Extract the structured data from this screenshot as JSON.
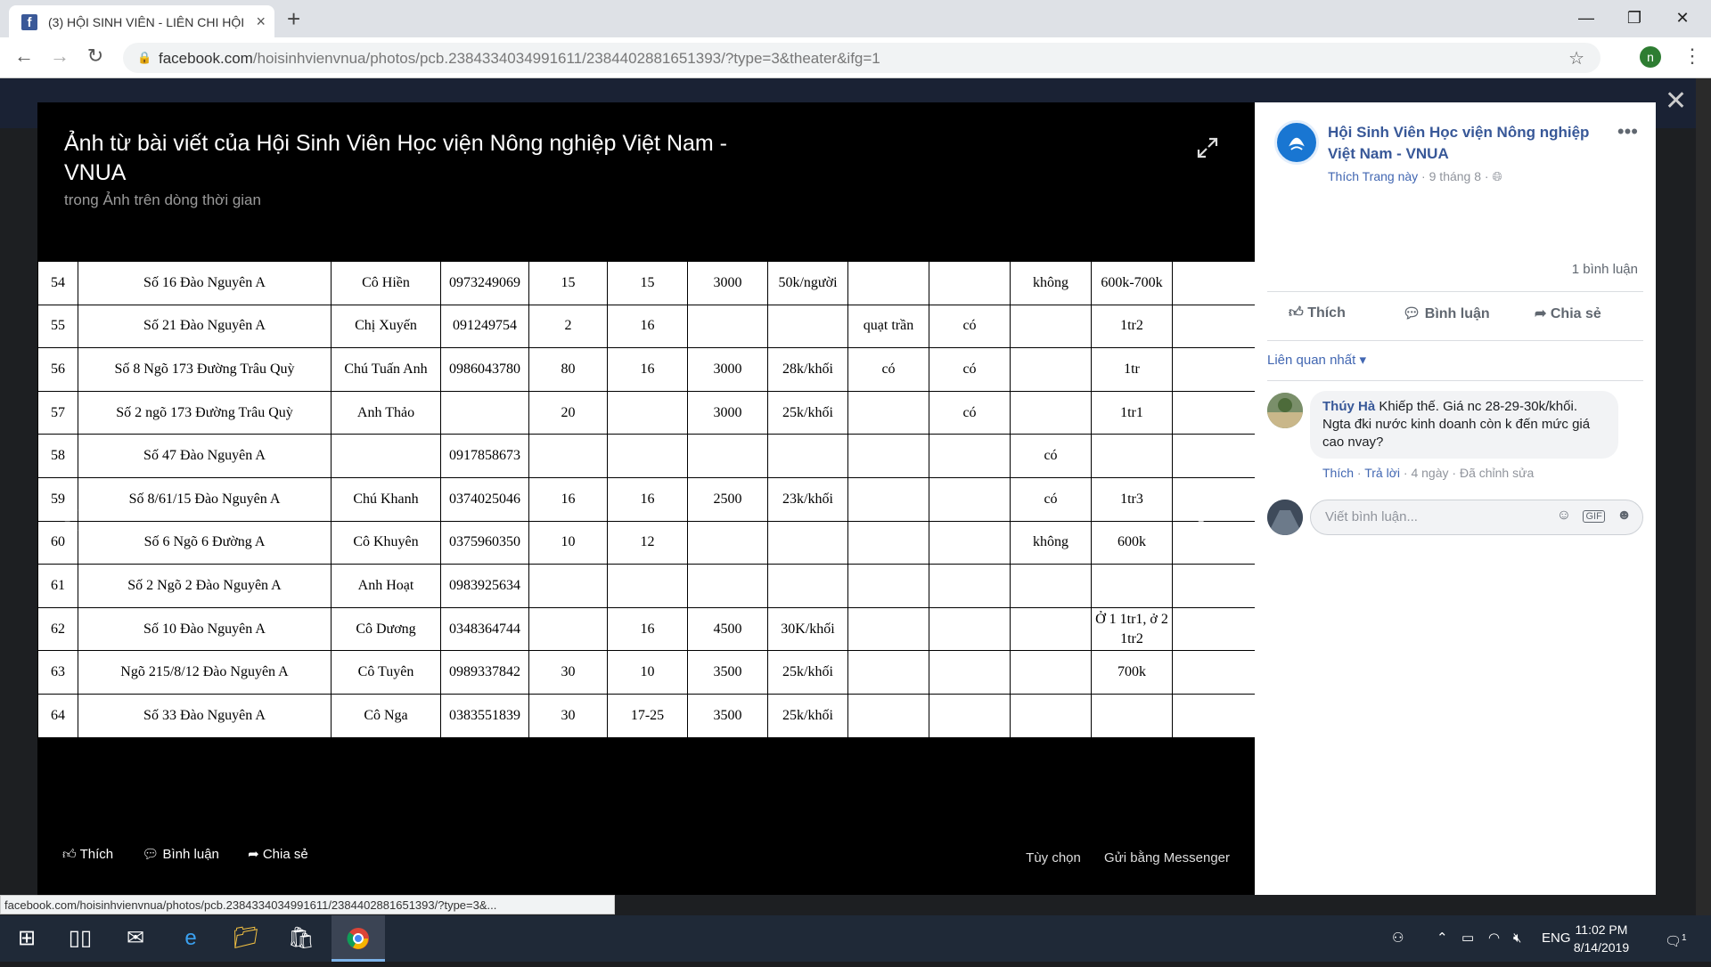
{
  "browser": {
    "tab_title": "(3) HỘI SINH VIÊN - LIÊN CHI HỘI",
    "tab_icon": "facebook-icon",
    "url_host": "facebook.com",
    "url_path": "/hoisinhvienvnua/photos/pcb.2384334034991611/2384402881651393/?type=3&theater&ifg=1",
    "profile_initial": "n"
  },
  "theater": {
    "title": "Ảnh từ bài viết của Hội Sinh Viên Học viện Nông nghiệp Việt Nam - VNUA",
    "subtitle": "trong Ảnh trên dòng thời gian",
    "like_label": "Thích",
    "comment_label": "Bình luận",
    "share_label": "Chia sẻ",
    "options_label": "Tùy chọn",
    "messenger_label": "Gửi bằng Messenger",
    "table_rows": [
      [
        "54",
        "Số 16 Đào Nguyên A",
        "Cô Hiền",
        "0973249069",
        "15",
        "15",
        "3000",
        "50k/người",
        "",
        "",
        "không",
        "600k-700k",
        ""
      ],
      [
        "55",
        "Số 21 Đào Nguyên A",
        "Chị Xuyến",
        "091249754",
        "2",
        "16",
        "",
        "",
        "quạt trần",
        "có",
        "",
        "1tr2",
        ""
      ],
      [
        "56",
        "Số 8 Ngõ 173 Đường Trâu Quỳ",
        "Chú Tuấn Anh",
        "0986043780",
        "80",
        "16",
        "3000",
        "28k/khối",
        "có",
        "có",
        "",
        "1tr",
        ""
      ],
      [
        "57",
        "Số 2 ngõ 173 Đường Trâu Quỳ",
        "Anh Thảo",
        "",
        "20",
        "",
        "3000",
        "25k/khối",
        "",
        "có",
        "",
        "1tr1",
        ""
      ],
      [
        "58",
        "Số 47 Đào Nguyên A",
        "",
        "0917858673",
        "",
        "",
        "",
        "",
        "",
        "",
        "có",
        "",
        ""
      ],
      [
        "59",
        "Số 8/61/15 Đào Nguyên A",
        "Chú Khanh",
        "0374025046",
        "16",
        "16",
        "2500",
        "23k/khối",
        "",
        "",
        "có",
        "1tr3",
        ""
      ],
      [
        "60",
        "Số 6 Ngõ 6 Đường A",
        "Cô Khuyên",
        "0375960350",
        "10",
        "12",
        "",
        "",
        "",
        "",
        "không",
        "600k",
        ""
      ],
      [
        "61",
        "Số 2 Ngõ 2 Đào Nguyên A",
        "Anh Hoạt",
        "0983925634",
        "",
        "",
        "",
        "",
        "",
        "",
        "",
        "",
        ""
      ],
      [
        "62",
        "Số 10 Đào Nguyên A",
        "Cô Dương",
        "0348364744",
        "",
        "16",
        "4500",
        "30K/khối",
        "",
        "",
        "",
        "Ở 1 1tr1, ở 2 1tr2",
        ""
      ],
      [
        "63",
        "Ngõ 215/8/12 Đào Nguyên A",
        "Cô Tuyên",
        "0989337842",
        "30",
        "10",
        "3500",
        "25k/khối",
        "",
        "",
        "",
        "700k",
        ""
      ],
      [
        "64",
        "Số 33 Đào Nguyên A",
        "Cô Nga",
        "0383551839",
        "30",
        "17-25",
        "3500",
        "25k/khối",
        "",
        "",
        "",
        "",
        ""
      ]
    ]
  },
  "panel": {
    "page_name": "Hội Sinh Viên Học viện Nông nghiệp Việt Nam - VNUA",
    "like_page": "Thích Trang này",
    "date": "9 tháng 8",
    "comment_count": "1 bình luận",
    "like_label": "Thích",
    "comment_label": "Bình luận",
    "share_label": "Chia sẻ",
    "sort_label": "Liên quan nhất",
    "comment": {
      "author": "Thúy Hà",
      "text": "Khiếp thế. Giá nc 28-29-30k/khối. Ngta đki nước kinh doanh còn k đến mức giá cao nvay?",
      "like": "Thích",
      "reply": "Trả lời",
      "time": "4 ngày",
      "edited": "Đã chỉnh sửa"
    },
    "write_placeholder": "Viết bình luận..."
  },
  "status_url": "facebook.com/hoisinhvienvnua/photos/pcb.2384334034991611/2384402881651393/?type=3&...",
  "taskbar": {
    "lang": "ENG",
    "time": "11:02 PM",
    "date": "8/14/2019",
    "notif_count": "1"
  }
}
